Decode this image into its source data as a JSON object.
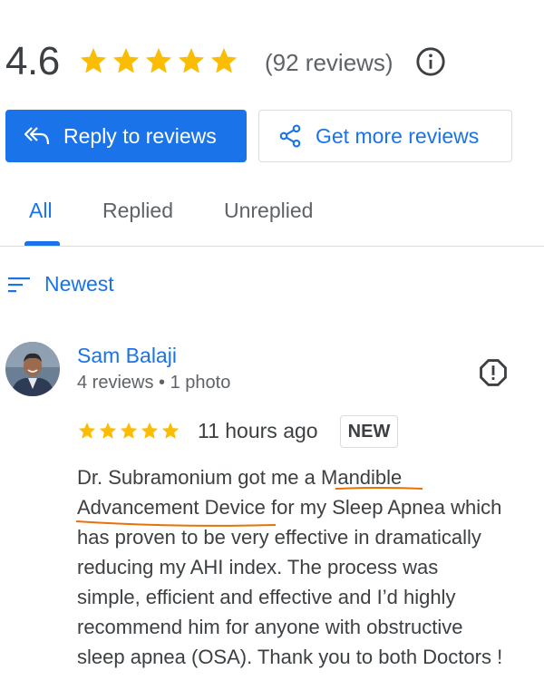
{
  "rating": {
    "value": "4.6",
    "stars": 5,
    "count_text": "(92 reviews)",
    "star_color": "#fbbc04"
  },
  "actions": {
    "reply_label": "Reply to reviews",
    "more_label": "Get more reviews"
  },
  "tabs": [
    {
      "label": "All",
      "selected": true
    },
    {
      "label": "Replied",
      "selected": false
    },
    {
      "label": "Unreplied",
      "selected": false
    }
  ],
  "sort": {
    "label": "Newest"
  },
  "review": {
    "author": "Sam Balaji",
    "meta": "4 reviews • 1 photo",
    "stars": 5,
    "time": "11 hours ago",
    "badge": "NEW",
    "lines": [
      "Dr. Subramonium got me a Mandible",
      "Advancement Device for my Sleep Apnea which",
      "has proven to be very effective in dramatically",
      "reducing my AHI index. The process was",
      "simple, efficient and effective and I’d highly",
      "recommend him for anyone with obstructive",
      "sleep apnea (OSA). Thank you to both Doctors !"
    ]
  },
  "colors": {
    "accent": "#1a73e8",
    "spellcheck_underline": "#e8710a"
  },
  "icons": {
    "info": "info-icon",
    "reply": "reply-all-icon",
    "share": "share-icon",
    "sort": "sort-icon",
    "flag": "report-icon"
  }
}
